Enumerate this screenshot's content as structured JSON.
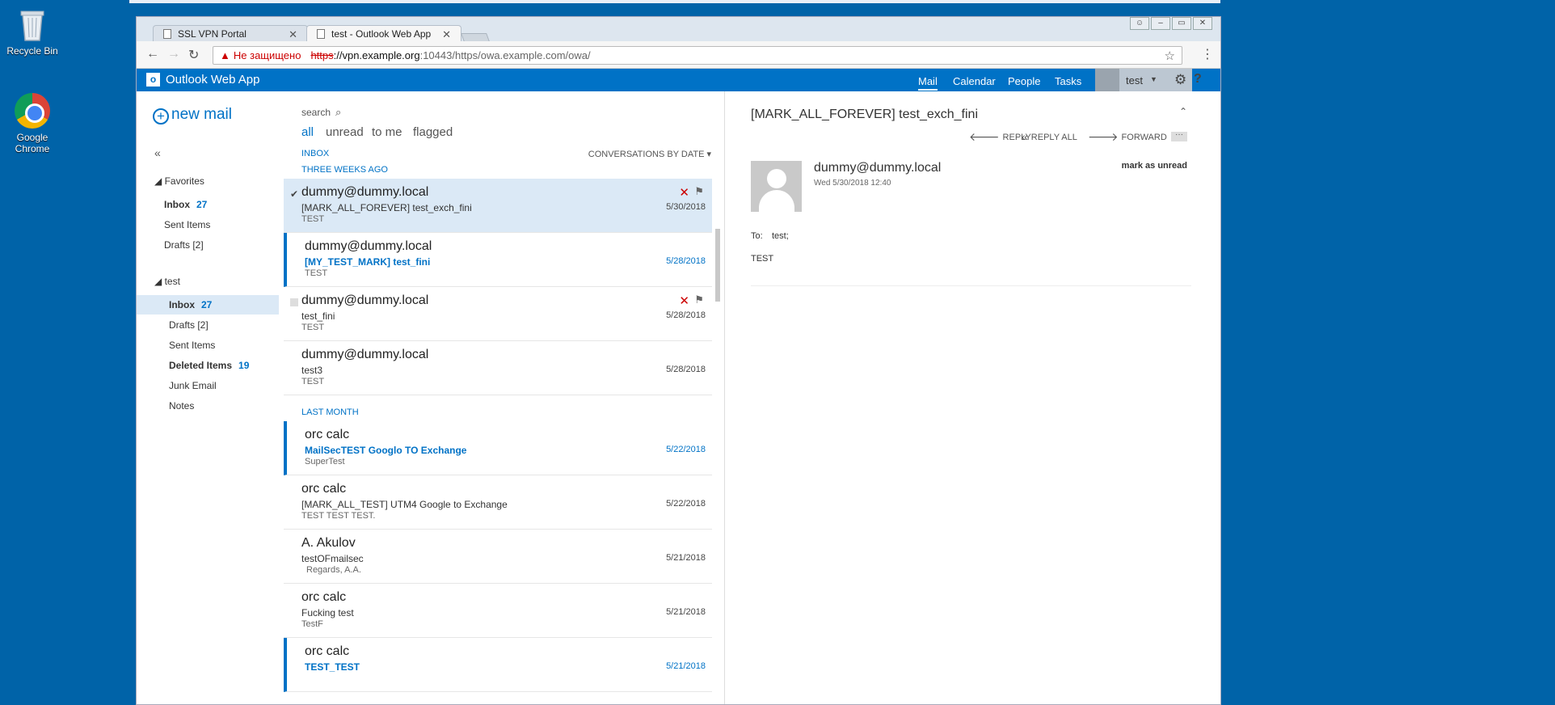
{
  "desktop": {
    "recycle_label": "Recycle Bin",
    "chrome_label_1": "Google",
    "chrome_label_2": "Chrome"
  },
  "browser": {
    "tabs": [
      {
        "label": "SSL VPN Portal"
      },
      {
        "label": "test - Outlook Web App"
      }
    ],
    "address": {
      "warning": "Не защищено",
      "scheme": "https",
      "host": "://vpn.example.org",
      "rest": ":10443/https/owa.example.com/owa/"
    }
  },
  "owa": {
    "app_title": "Outlook Web App",
    "nav": [
      "Mail",
      "Calendar",
      "People",
      "Tasks"
    ],
    "user": "test"
  },
  "leftnav": {
    "new_mail": "new mail",
    "favorites_label": "Favorites",
    "favorites": [
      {
        "name": "Inbox",
        "count": "27"
      },
      {
        "name": "Sent Items",
        "count": ""
      },
      {
        "name": "Drafts [2]",
        "count": ""
      }
    ],
    "account_label": "test",
    "folders": [
      {
        "name": "Inbox",
        "count": "27"
      },
      {
        "name": "Drafts [2]",
        "count": ""
      },
      {
        "name": "Sent Items",
        "count": ""
      },
      {
        "name": "Deleted Items",
        "count": "19"
      },
      {
        "name": "Junk Email",
        "count": ""
      },
      {
        "name": "Notes",
        "count": ""
      }
    ]
  },
  "msglist": {
    "search_placeholder": "search",
    "filters": [
      "all",
      "unread",
      "to me",
      "flagged"
    ],
    "folder_label": "INBOX",
    "sort_label": "CONVERSATIONS BY DATE",
    "group1": "THREE WEEKS AGO",
    "group2": "LAST MONTH",
    "rows": [
      {
        "from": "dummy@dummy.local",
        "subject": "[MARK_ALL_FOREVER] test_exch_fini",
        "preview": "TEST",
        "date": "5/30/2018"
      },
      {
        "from": "dummy@dummy.local",
        "subject": "[MY_TEST_MARK] test_fini",
        "preview": "TEST",
        "date": "5/28/2018"
      },
      {
        "from": "dummy@dummy.local",
        "subject": "test_fini",
        "preview": "TEST",
        "date": "5/28/2018"
      },
      {
        "from": "dummy@dummy.local",
        "subject": "test3",
        "preview": "TEST",
        "date": "5/28/2018"
      },
      {
        "from": "orc calc",
        "subject": "MailSecTEST Googlo TO Exchange",
        "preview": "SuperTest",
        "date": "5/22/2018"
      },
      {
        "from": "orc calc",
        "subject": "[MARK_ALL_TEST] UTM4 Google to Exchange",
        "preview": "TEST TEST TEST.",
        "date": "5/22/2018"
      },
      {
        "from": "A. Akulov",
        "subject": "testOFmailsec",
        "preview": "Regards, A.A.",
        "date": "5/21/2018"
      },
      {
        "from": "orc calc",
        "subject": "Fucking test",
        "preview": "TestF",
        "date": "5/21/2018"
      },
      {
        "from": "orc calc",
        "subject": "TEST_TEST",
        "preview": "",
        "date": "5/21/2018"
      }
    ]
  },
  "reading": {
    "subject": "[MARK_ALL_FOREVER] test_exch_fini",
    "reply": "REPLY",
    "reply_all": "REPLY ALL",
    "forward": "FORWARD",
    "from": "dummy@dummy.local",
    "date": "Wed 5/30/2018 12:40",
    "mark_unread": "mark as unread",
    "to_label": "To:",
    "to_value": "test;",
    "body": "TEST"
  }
}
